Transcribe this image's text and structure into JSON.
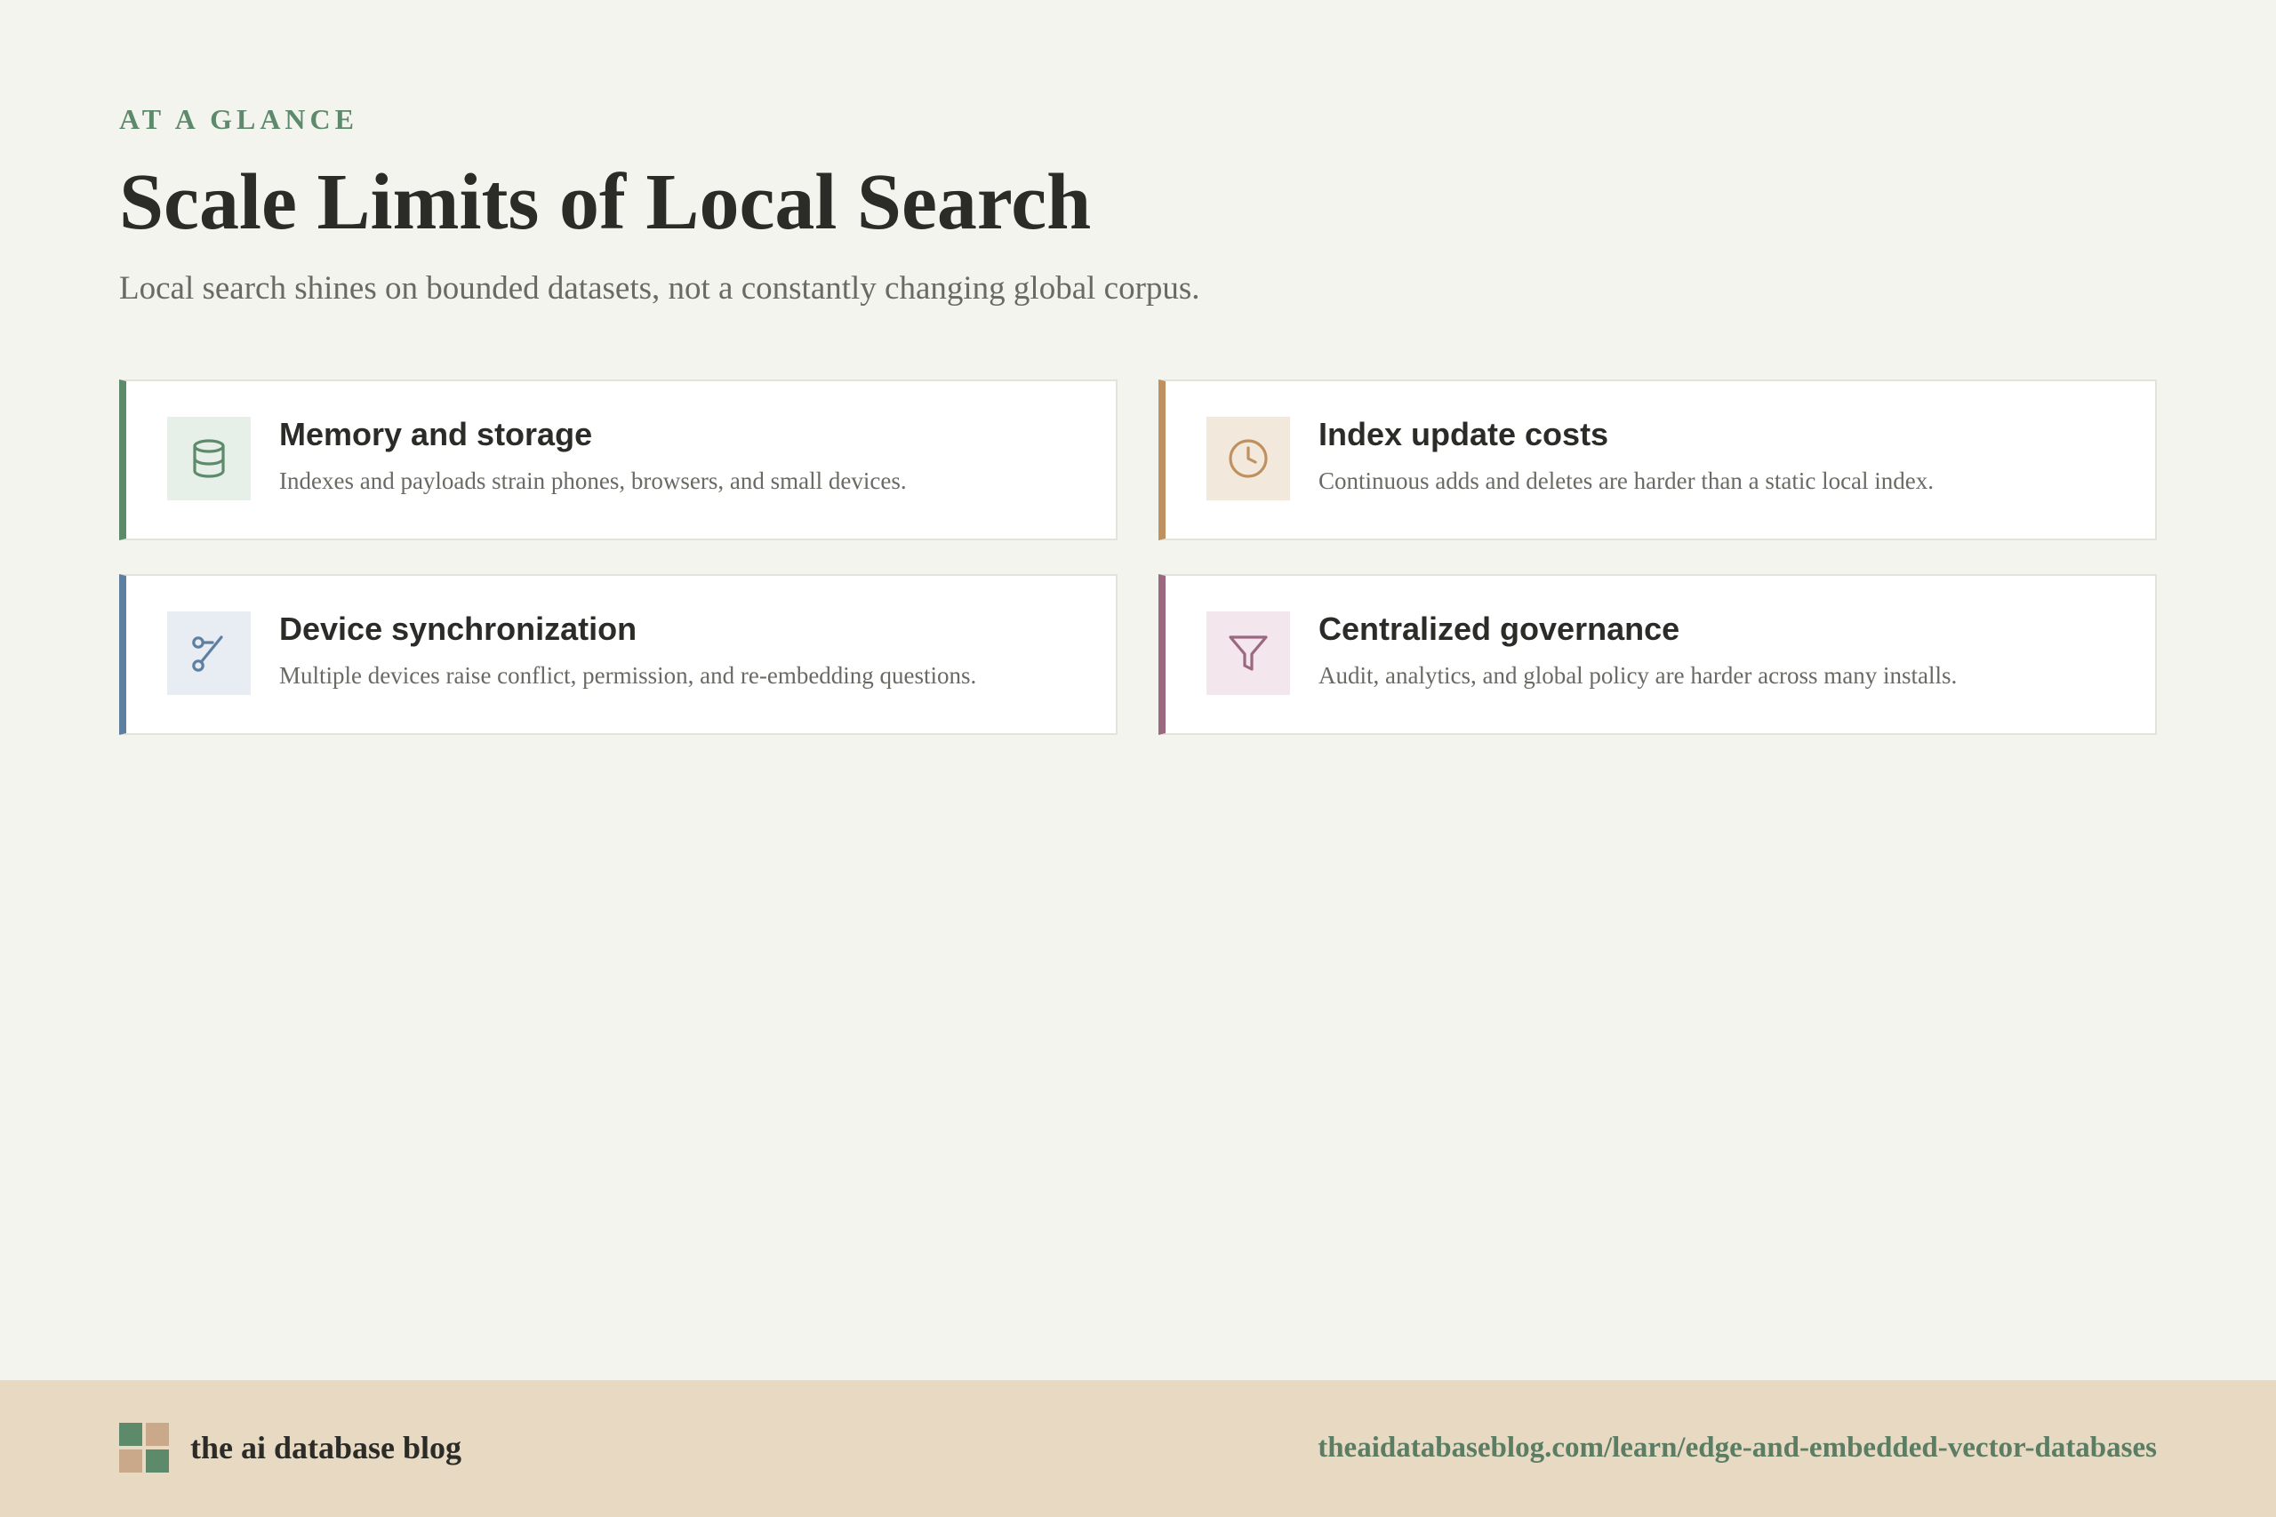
{
  "header": {
    "eyebrow": "AT A GLANCE",
    "title": "Scale Limits of Local Search",
    "subtitle": "Local search shines on bounded datasets, not a constantly changing global corpus."
  },
  "cards": [
    {
      "title": "Memory and storage",
      "description": "Indexes and payloads strain phones, browsers, and small devices.",
      "icon": "database-icon",
      "accent": "#5e8a6c"
    },
    {
      "title": "Index update costs",
      "description": "Continuous adds and deletes are harder than a static local index.",
      "icon": "clock-icon",
      "accent": "#bf9160"
    },
    {
      "title": "Device synchronization",
      "description": "Multiple devices raise conflict, permission, and re-embedding questions.",
      "icon": "git-branch-icon",
      "accent": "#5f7fa1"
    },
    {
      "title": "Centralized governance",
      "description": "Audit, analytics, and global policy are harder across many installs.",
      "icon": "filter-icon",
      "accent": "#9c6880"
    }
  ],
  "footer": {
    "brand_name": "the ai database blog",
    "url": "theaidatabaseblog.com/learn/edge-and-embedded-vector-databases"
  }
}
